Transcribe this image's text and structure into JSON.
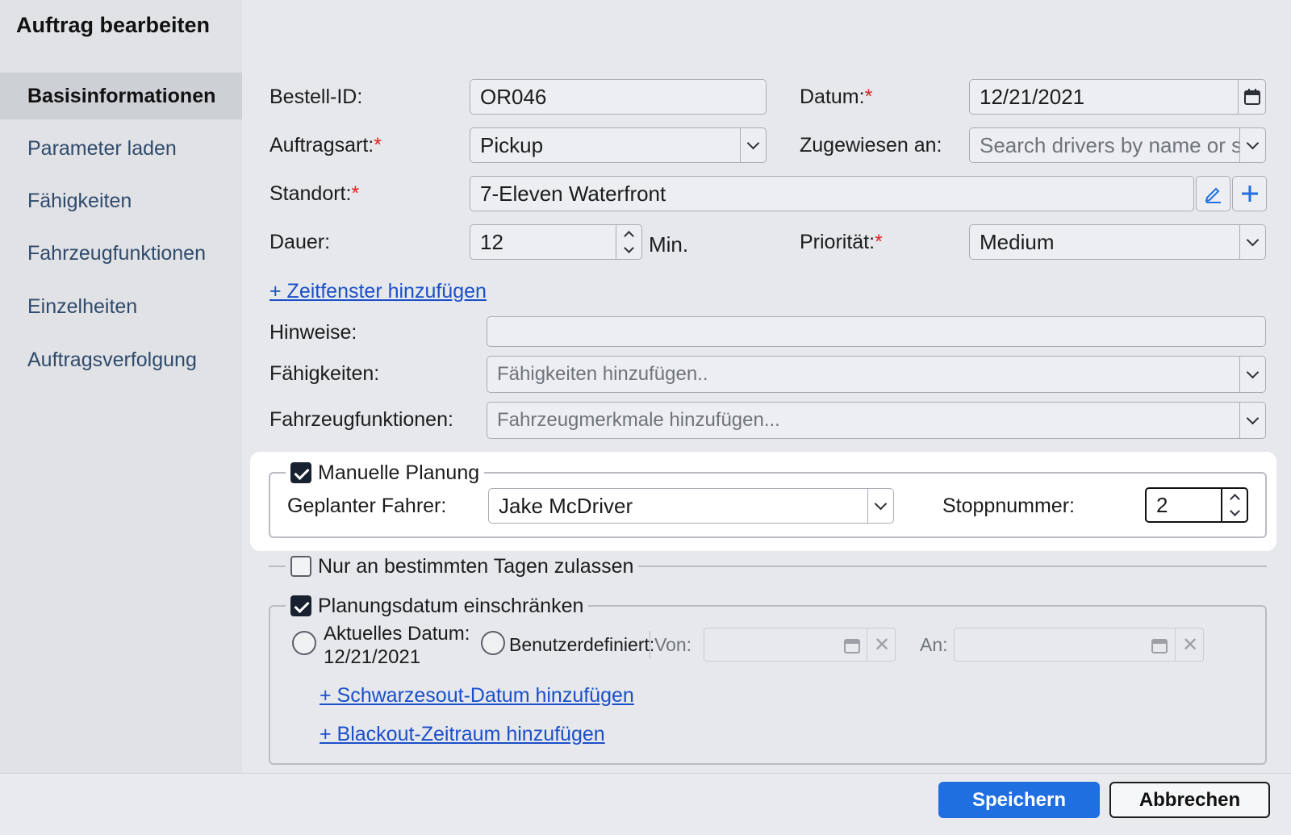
{
  "dialog": {
    "title": "Auftrag bearbeiten"
  },
  "sidebar": {
    "items": [
      {
        "label": "Basisinformationen",
        "active": true
      },
      {
        "label": "Parameter laden"
      },
      {
        "label": "Fähigkeiten"
      },
      {
        "label": "Fahrzeugfunktionen"
      },
      {
        "label": "Einzelheiten"
      },
      {
        "label": "Auftragsverfolgung"
      }
    ]
  },
  "form": {
    "order_id": {
      "label": "Bestell-ID:",
      "value": "OR046"
    },
    "date": {
      "label": "Datum:",
      "required": "*",
      "value": "12/21/2021"
    },
    "order_type": {
      "label": "Auftragsart:",
      "required": "*",
      "value": "Pickup"
    },
    "assigned_to": {
      "label": "Zugewiesen an:",
      "placeholder": "Search drivers by name or s"
    },
    "location": {
      "label": "Standort:",
      "required": "*",
      "value": "7-Eleven Waterfront"
    },
    "duration": {
      "label": "Dauer:",
      "value": "12",
      "unit": "Min."
    },
    "priority": {
      "label": "Priorität:",
      "required": "*",
      "value": "Medium"
    },
    "add_time_window": "+ Zeitfenster hinzufügen",
    "notes": {
      "label": "Hinweise:",
      "value": ""
    },
    "skills": {
      "label": "Fähigkeiten:",
      "placeholder": "Fähigkeiten hinzufügen.."
    },
    "vehicle_features": {
      "label": "Fahrzeugfunktionen:",
      "placeholder": "Fahrzeugmerkmale hinzufügen..."
    }
  },
  "manual_planning": {
    "label": "Manuelle Planung",
    "checked": true,
    "driver_label": "Geplanter Fahrer:",
    "driver_value": "Jake McDriver",
    "stop_label": "Stoppnummer:",
    "stop_value": "2"
  },
  "specific_days": {
    "label": "Nur an bestimmten Tagen zulassen",
    "checked": false
  },
  "restrict_date": {
    "label": "Planungsdatum einschränken",
    "checked": true,
    "current_date_label": "Aktuelles Datum:",
    "current_date_value": "12/21/2021",
    "custom_label": "Benutzerdefiniert:",
    "from_label": "Von:",
    "to_label": "An:",
    "add_blackout_date": "+ Schwarzesout-Datum hinzufügen",
    "add_blackout_period": "+ Blackout-Zeitraum hinzufügen"
  },
  "footer": {
    "save_label": "Speichern",
    "cancel_label": "Abbrechen"
  },
  "colors": {
    "primary": "#1f6fe0",
    "link": "#1b4fc9",
    "required": "#e0201c",
    "checkbox_checked": "#17212f"
  }
}
